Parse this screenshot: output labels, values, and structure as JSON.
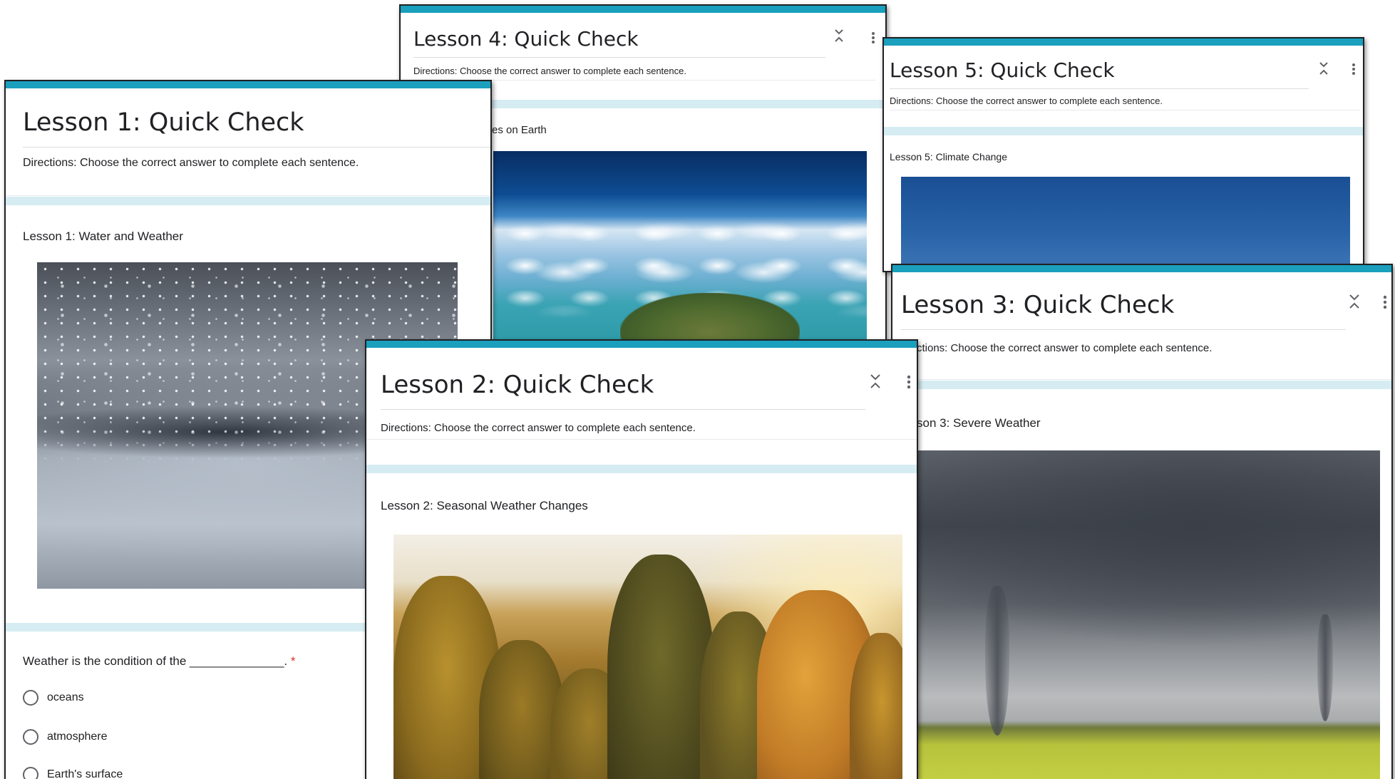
{
  "accent_color": "#1a9fbd",
  "band_color": "#d5ecf2",
  "forms": {
    "lesson4": {
      "title": "Lesson 4: Quick Check",
      "directions": "Directions: Choose the correct answer to complete each sentence.",
      "section_label": "es on Earth",
      "image": "earth-from-space-photo"
    },
    "lesson5": {
      "title": "Lesson 5: Quick Check",
      "directions": "Directions: Choose the correct answer to complete each sentence.",
      "section_label": "Lesson 5: Climate Change",
      "image": "sky-photo"
    },
    "lesson1": {
      "title": "Lesson 1: Quick Check",
      "directions": "Directions: Choose the correct answer to complete each sentence.",
      "section_label": "Lesson 1: Water and Weather",
      "image": "rain-photo",
      "question": {
        "text": "Weather is the condition of the ______________. ",
        "required_mark": "*",
        "options": [
          "oceans",
          "atmosphere",
          "Earth's surface"
        ]
      }
    },
    "lesson3": {
      "title": "Lesson 3: Quick Check",
      "directions": "ctions: Choose the correct answer to complete each sentence.",
      "section_label": "son 3: Severe Weather",
      "image": "tornado-photo"
    },
    "lesson2": {
      "title": "Lesson 2: Quick Check",
      "directions": "Directions: Choose the correct answer to complete each sentence.",
      "section_label": "Lesson 2: Seasonal Weather Changes",
      "image": "autumn-forest-photo"
    }
  },
  "icons": {
    "collapse": "collapse-icon",
    "more": "more-vert-icon"
  }
}
